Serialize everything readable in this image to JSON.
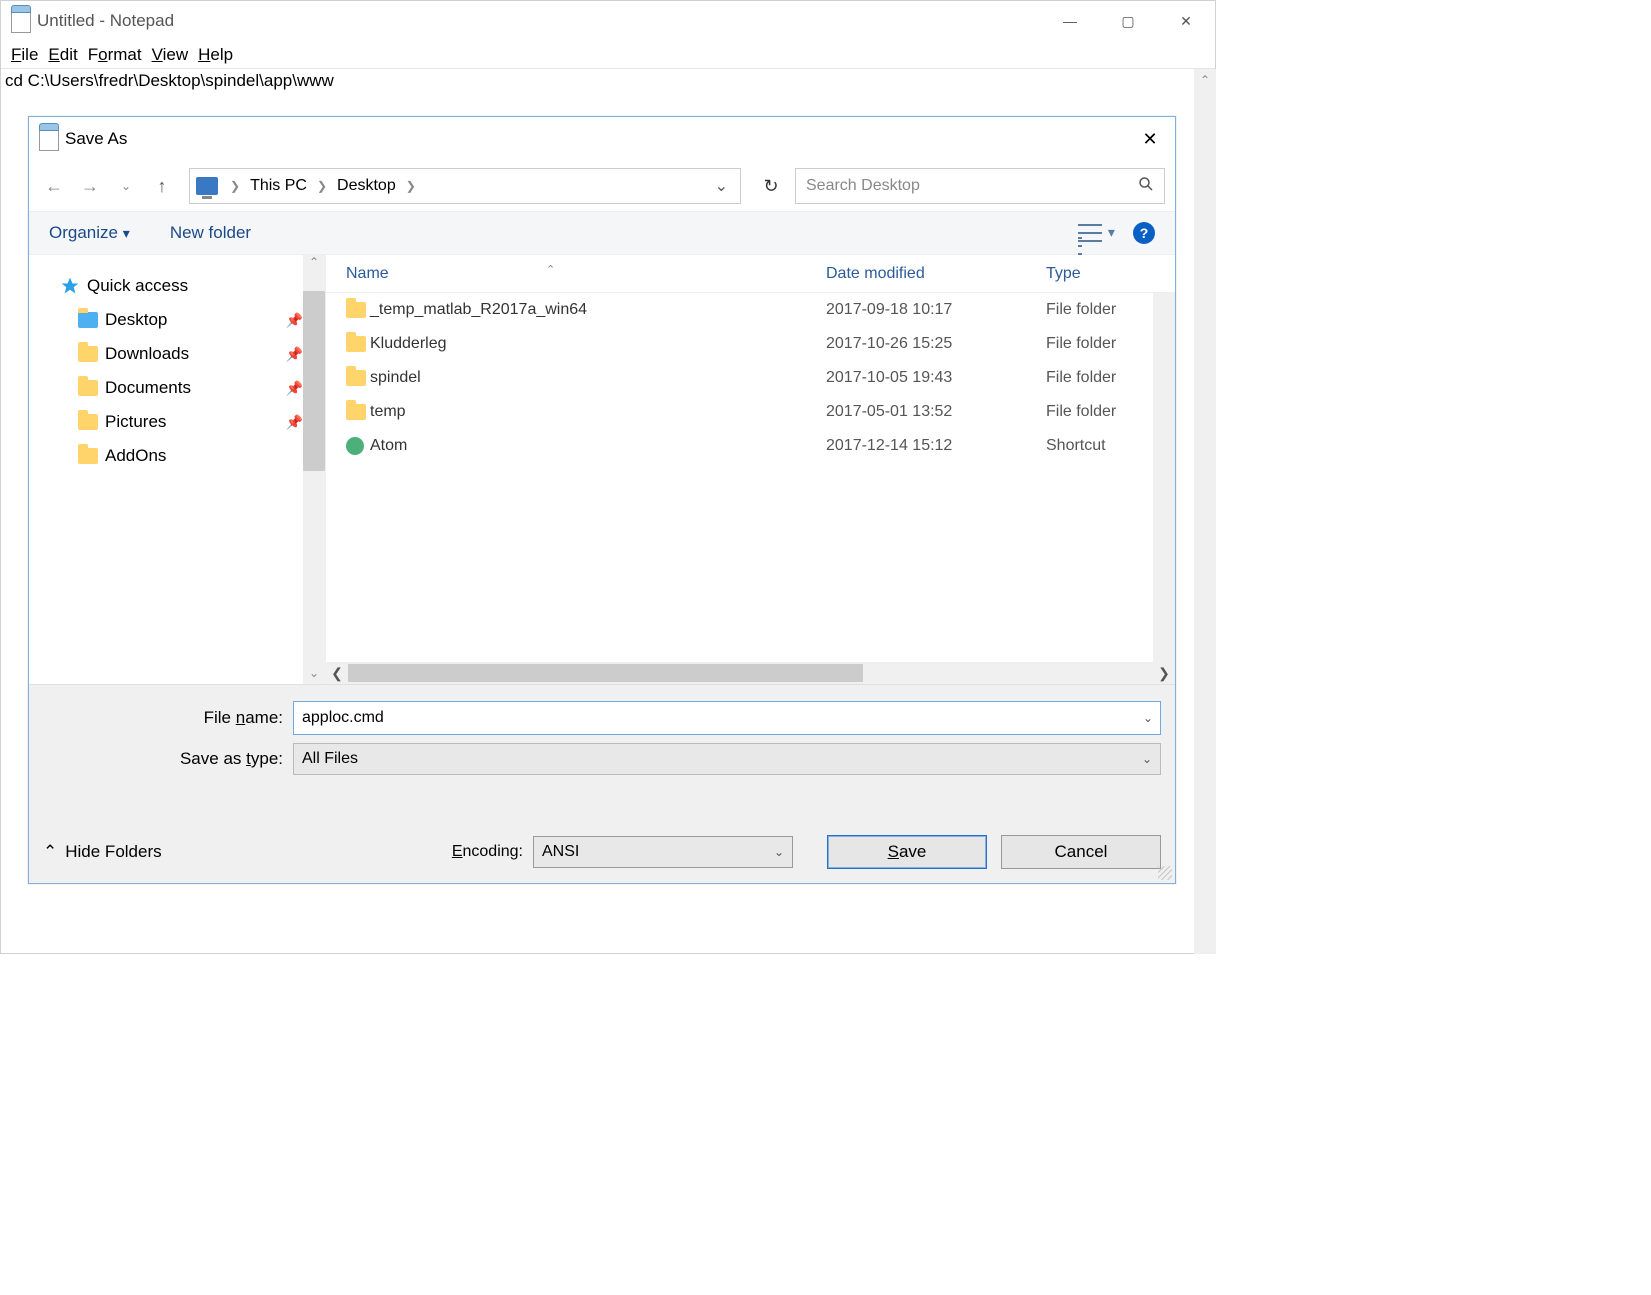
{
  "notepad": {
    "title": "Untitled - Notepad",
    "menu": {
      "file": "File",
      "edit": "Edit",
      "format": "Format",
      "view": "View",
      "help": "Help"
    },
    "content": "cd C:\\Users\\fredr\\Desktop\\spindel\\app\\www"
  },
  "saveas": {
    "title": "Save As",
    "breadcrumb": {
      "root": "This PC",
      "folder": "Desktop"
    },
    "search_placeholder": "Search Desktop",
    "toolbar": {
      "organize": "Organize",
      "newfolder": "New folder"
    },
    "tree": {
      "quick": "Quick access",
      "items": [
        {
          "label": "Desktop",
          "icon": "desktop"
        },
        {
          "label": "Downloads",
          "icon": "downloads"
        },
        {
          "label": "Documents",
          "icon": "documents"
        },
        {
          "label": "Pictures",
          "icon": "pictures"
        },
        {
          "label": "AddOns",
          "icon": "folder"
        }
      ]
    },
    "columns": {
      "name": "Name",
      "date": "Date modified",
      "type": "Type"
    },
    "files": [
      {
        "name": "_temp_matlab_R2017a_win64",
        "date": "2017-09-18 10:17",
        "type": "File folder",
        "icon": "folder"
      },
      {
        "name": "Kludderleg",
        "date": "2017-10-26 15:25",
        "type": "File folder",
        "icon": "folder"
      },
      {
        "name": "spindel",
        "date": "2017-10-05 19:43",
        "type": "File folder",
        "icon": "folder"
      },
      {
        "name": "temp",
        "date": "2017-05-01 13:52",
        "type": "File folder",
        "icon": "folder"
      },
      {
        "name": "Atom",
        "date": "2017-12-14 15:12",
        "type": "Shortcut",
        "icon": "atom"
      }
    ],
    "labels": {
      "filename": "File name:",
      "saveastype": "Save as type:",
      "encoding": "Encoding:",
      "hidefolders": "Hide Folders",
      "save": "Save",
      "cancel": "Cancel"
    },
    "values": {
      "filename": "apploc.cmd",
      "saveastype": "All Files",
      "encoding": "ANSI"
    }
  }
}
